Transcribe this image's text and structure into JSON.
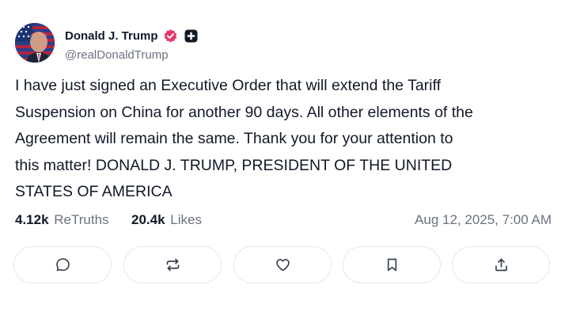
{
  "author": {
    "display_name": "Donald J. Trump",
    "handle": "@realDonaldTrump",
    "avatar_icon": "flag-portrait-avatar",
    "verified_icon": "verified-badge-icon",
    "verified_color": "#e5396b",
    "badge_icon": "plus-badge-icon"
  },
  "post": {
    "text": "I have just signed an Executive Order that will extend the Tariff Suspension on China for another 90 days. All other elements of the Agreement will remain the same. Thank you for your attention to this matter! DONALD J. TRUMP, PRESIDENT OF THE UNITED STATES OF AMERICA",
    "lines": [
      "I have just signed an Executive Order that will extend the Tariff",
      "Suspension on China for another 90 days. All other elements of the",
      "Agreement will remain the same. Thank you for your attention to",
      "this matter! DONALD J. TRUMP, PRESIDENT OF THE UNITED",
      "STATES OF AMERICA"
    ]
  },
  "stats": {
    "retruths_count": "4.12k",
    "retruths_label": "ReTruths",
    "likes_count": "20.4k",
    "likes_label": "Likes",
    "timestamp": "Aug 12, 2025, 7:00 AM"
  },
  "actions": [
    {
      "name": "reply",
      "icon": "comment-icon"
    },
    {
      "name": "retruth",
      "icon": "repost-icon"
    },
    {
      "name": "like",
      "icon": "heart-icon"
    },
    {
      "name": "bookmark",
      "icon": "bookmark-icon"
    },
    {
      "name": "share",
      "icon": "share-icon"
    }
  ],
  "colors": {
    "text": "#111827",
    "muted": "#6b7280",
    "border": "#e5e7eb",
    "icon": "#374151"
  }
}
